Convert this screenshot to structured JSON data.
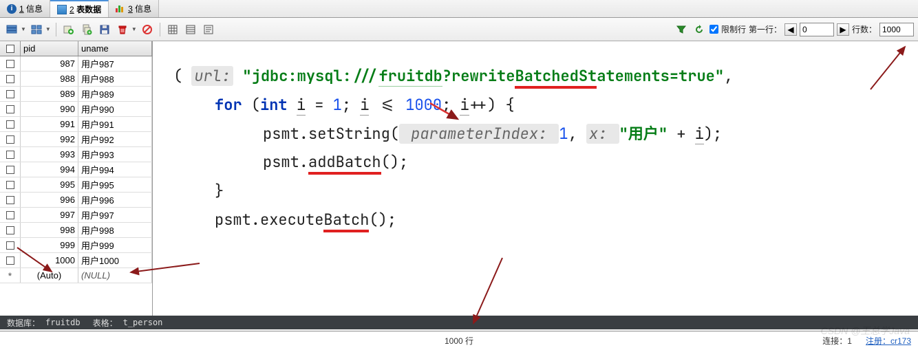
{
  "tabs": [
    {
      "num": "1",
      "label": "信息"
    },
    {
      "num": "2",
      "label": "表数据"
    },
    {
      "num": "3",
      "label": "信息"
    }
  ],
  "toolbar": {
    "limit_label": "限制行",
    "first_row_label": "第一行：",
    "first_row_value": "0",
    "row_count_label": "行数：",
    "row_count_value": "1000"
  },
  "table": {
    "headers": {
      "pid": "pid",
      "uname": "uname"
    },
    "rows": [
      {
        "pid": "987",
        "uname": "用户987"
      },
      {
        "pid": "988",
        "uname": "用户988"
      },
      {
        "pid": "989",
        "uname": "用户989"
      },
      {
        "pid": "990",
        "uname": "用户990"
      },
      {
        "pid": "991",
        "uname": "用户991"
      },
      {
        "pid": "992",
        "uname": "用户992"
      },
      {
        "pid": "993",
        "uname": "用户993"
      },
      {
        "pid": "994",
        "uname": "用户994"
      },
      {
        "pid": "995",
        "uname": "用户995"
      },
      {
        "pid": "996",
        "uname": "用户996"
      },
      {
        "pid": "997",
        "uname": "用户997"
      },
      {
        "pid": "998",
        "uname": "用户998"
      },
      {
        "pid": "999",
        "uname": "用户999"
      },
      {
        "pid": "1000",
        "uname": "用户1000"
      }
    ],
    "auto": {
      "pid": "(Auto)",
      "uname": "(NULL)"
    }
  },
  "code": {
    "url_param": "url:",
    "url_str1": "\"jdbc:mysql:///",
    "url_str2": "fruitdb",
    "url_str3": "?rewrite",
    "url_str4": "BatchedSt",
    "url_str5": "atements=true\"",
    "kw_for": "for",
    "kw_int": "int",
    "var_i": "i",
    "eq": " = ",
    "one": "1",
    "cond": "; ",
    "lte": " <= ",
    "limit": "1000",
    "incr": "++) {",
    "psmt1": "psmt.setString(",
    "pidx_lbl": " parameterIndex: ",
    "pidx_val": "1",
    "comma": ",  ",
    "x_lbl": "x: ",
    "user_str": "\"用户\"",
    "plus": " + ",
    "close1": ");",
    "psmt2a": "psmt.",
    "psmt2b": "addBatch",
    "psmt2c": "();",
    "brace": "}",
    "psmt3a": "psmt.execute",
    "psmt3b": "Batch",
    "psmt3c": "();"
  },
  "status": {
    "db_label": "数据库：",
    "db_val": "fruitdb",
    "tbl_label": "表格：",
    "tbl_val": "t_person",
    "rows": "1000 行",
    "conn": "连接：1",
    "reg": "注册：cr173"
  },
  "watermark": "CSDN @王总学Java"
}
